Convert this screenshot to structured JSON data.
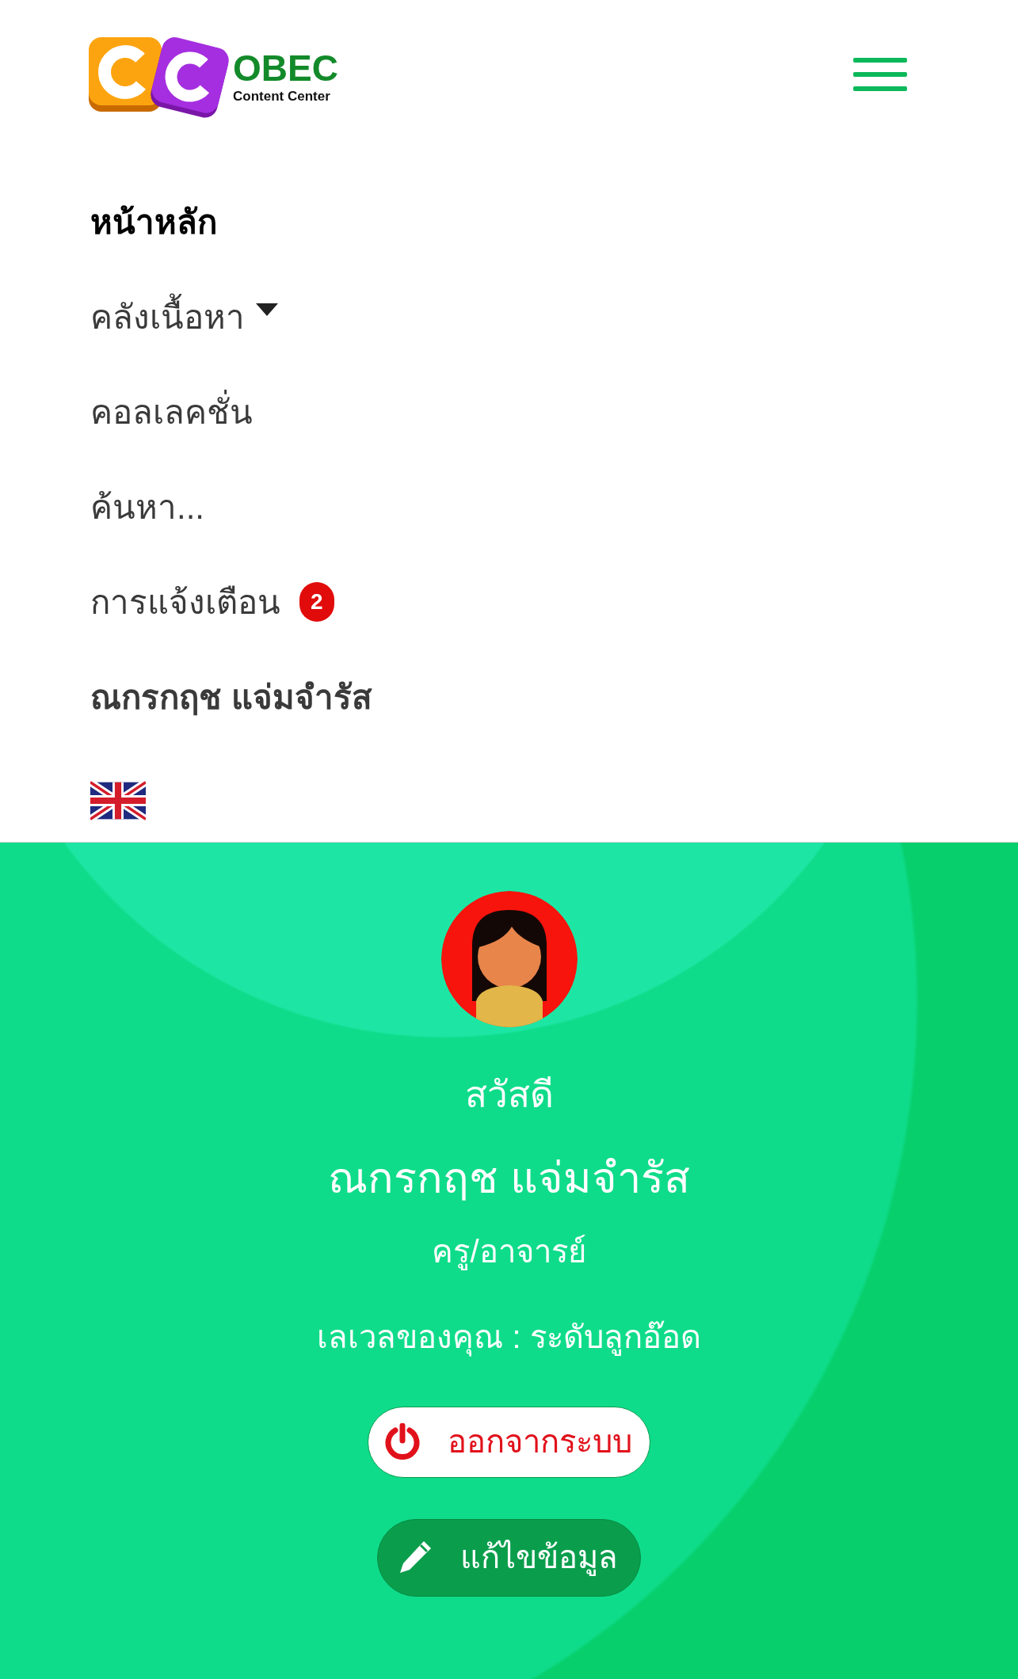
{
  "header": {
    "logo": {
      "title": "OBEC",
      "subtitle": "Content Center"
    }
  },
  "nav": [
    {
      "label": "หน้าหลัก",
      "kind": "link",
      "selected": true
    },
    {
      "label": "คลังเนื้อหา",
      "kind": "dropdown",
      "selected": false
    },
    {
      "label": "คอลเลคชั่น",
      "kind": "link",
      "selected": false
    },
    {
      "label": "ค้นหา...",
      "kind": "link",
      "selected": false
    },
    {
      "label": "การแจ้งเตือน",
      "kind": "badge",
      "badge": "2",
      "selected": false
    },
    {
      "label": "ณกรกฤช แจ่มจำรัส",
      "kind": "user",
      "selected": false
    },
    {
      "kind": "flag",
      "selected": false
    }
  ],
  "profile": {
    "greeting": "สวัสดี",
    "name": "ณกรกฤช แจ่มจำรัส",
    "role": "ครู/อาจารย์",
    "level": "เลเวลของคุณ : ระดับลูกอ๊อด",
    "buttons": [
      {
        "label": "ออกจากระบบ",
        "kind": "logout"
      },
      {
        "label": "แก้ไขข้อมูล",
        "kind": "edit"
      }
    ]
  }
}
